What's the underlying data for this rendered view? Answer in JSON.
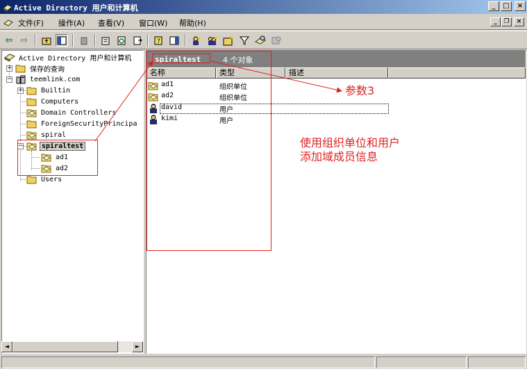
{
  "window": {
    "title": "Active Directory 用户和计算机",
    "buttons": {
      "minimize": "_",
      "maximize": "□",
      "close": "×"
    }
  },
  "menubar": {
    "items": [
      {
        "label": "文件(F)"
      },
      {
        "label": "操作(A)"
      },
      {
        "label": "查看(V)"
      },
      {
        "label": "窗口(W)"
      },
      {
        "label": "帮助(H)"
      }
    ],
    "mdi": {
      "minimize": "_",
      "restore": "❐",
      "close": "×"
    }
  },
  "toolbar": {
    "back_icon": "⇦",
    "forward_icon": "⇨",
    "buttons": [
      "up-folder",
      "show-console-tree",
      "delete",
      "properties",
      "refresh",
      "export-list",
      "help",
      "show-hide-pane",
      "new-user",
      "new-group",
      "new-ou",
      "filter",
      "find",
      "add-to-group"
    ]
  },
  "tree": {
    "root": "Active Directory 用户和计算机",
    "saved_queries": "保存的查询",
    "domain": "teemlink.com",
    "nodes": [
      {
        "label": "Builtin",
        "icon": "folder"
      },
      {
        "label": "Computers",
        "icon": "folder"
      },
      {
        "label": "Domain Controllers",
        "icon": "ou"
      },
      {
        "label": "ForeignSecurityPrincipa",
        "icon": "folder"
      },
      {
        "label": "spiral",
        "icon": "ou"
      },
      {
        "label": "spiraltest",
        "icon": "ou"
      },
      {
        "label": "ad1",
        "icon": "ou"
      },
      {
        "label": "ad2",
        "icon": "ou"
      },
      {
        "label": "Users",
        "icon": "folder"
      }
    ],
    "expander_plus": "+",
    "expander_minus": "−"
  },
  "right": {
    "folder_name": "spiraltest",
    "object_count": "4 个对象",
    "columns": [
      "名称",
      "类型",
      "描述"
    ],
    "rows": [
      {
        "name": "ad1",
        "type": "组织单位",
        "icon": "ou"
      },
      {
        "name": "ad2",
        "type": "组织单位",
        "icon": "ou"
      },
      {
        "name": "david",
        "type": "用户",
        "icon": "user"
      },
      {
        "name": "kimi",
        "type": "用户",
        "icon": "user"
      }
    ]
  },
  "annotations": {
    "param_label": "参数3",
    "note_line1": "使用组织单位和用户",
    "note_line2": "添加域成员信息",
    "color": "#e02020"
  },
  "scrollbar": {
    "left_arrow": "◄",
    "right_arrow": "►"
  }
}
